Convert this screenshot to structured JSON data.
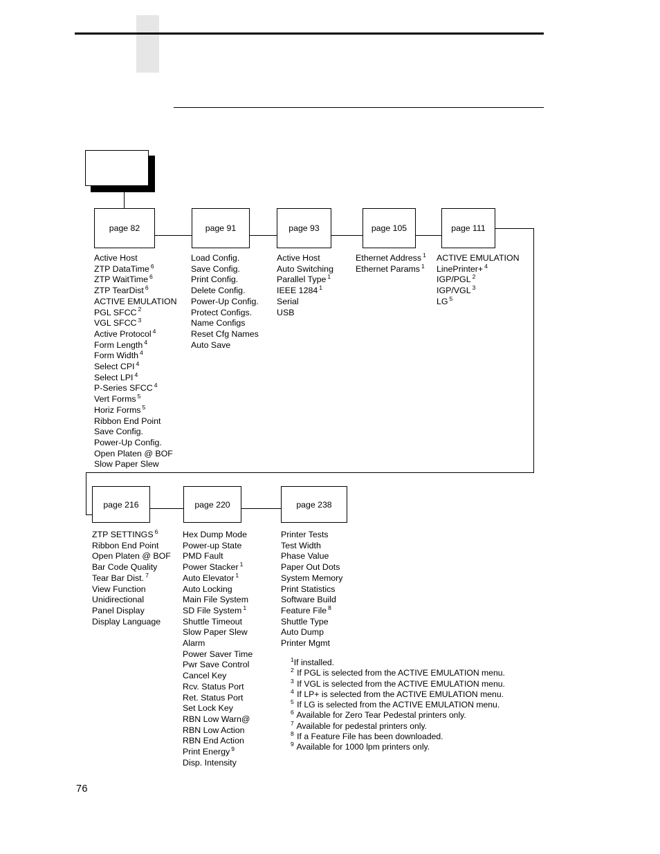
{
  "page": {
    "number": "76"
  },
  "chart": {
    "root": {
      "label": ""
    },
    "row1": [
      {
        "id": "page-82",
        "label": "page 82"
      },
      {
        "id": "page-91",
        "label": "page 91"
      },
      {
        "id": "page-93",
        "label": "page 93"
      },
      {
        "id": "page-105",
        "label": "page 105"
      },
      {
        "id": "page-111",
        "label": "page 111"
      }
    ],
    "row2": [
      {
        "id": "page-216",
        "label": "page 216"
      },
      {
        "id": "page-220",
        "label": "page 220"
      },
      {
        "id": "page-238",
        "label": "page 238"
      }
    ],
    "columns": {
      "page82": [
        {
          "text": "Active Host",
          "note": ""
        },
        {
          "text": "ZTP DataTime",
          "note": "6"
        },
        {
          "text": "ZTP WaitTime",
          "note": "6"
        },
        {
          "text": "ZTP TearDist",
          "note": "6"
        },
        {
          "text": "ACTIVE EMULATION",
          "note": ""
        },
        {
          "text": "PGL SFCC",
          "note": "2"
        },
        {
          "text": "VGL SFCC",
          "note": "3"
        },
        {
          "text": "Active Protocol",
          "note": "4"
        },
        {
          "text": "Form Length",
          "note": "4"
        },
        {
          "text": "Form Width",
          "note": "4"
        },
        {
          "text": "Select CPI",
          "note": "4"
        },
        {
          "text": "Select LPI",
          "note": "4"
        },
        {
          "text": "P-Series SFCC",
          "note": "4"
        },
        {
          "text": "Vert Forms",
          "note": "5"
        },
        {
          "text": "Horiz Forms",
          "note": "5"
        },
        {
          "text": "Ribbon End Point",
          "note": ""
        },
        {
          "text": "Save Config.",
          "note": ""
        },
        {
          "text": "Power-Up Config.",
          "note": ""
        },
        {
          "text": "Open Platen @ BOF",
          "note": ""
        },
        {
          "text": "Slow Paper Slew",
          "note": ""
        }
      ],
      "page91": [
        {
          "text": "Load Config.",
          "note": ""
        },
        {
          "text": "Save Config.",
          "note": ""
        },
        {
          "text": "Print Config.",
          "note": ""
        },
        {
          "text": "Delete Config.",
          "note": ""
        },
        {
          "text": "Power-Up Config.",
          "note": ""
        },
        {
          "text": "Protect Configs.",
          "note": ""
        },
        {
          "text": "Name Configs",
          "note": ""
        },
        {
          "text": "Reset Cfg Names",
          "note": ""
        },
        {
          "text": "Auto Save",
          "note": ""
        }
      ],
      "page93": [
        {
          "text": "Active Host",
          "note": ""
        },
        {
          "text": "Auto Switching",
          "note": ""
        },
        {
          "text": "Parallel Type",
          "note": "1"
        },
        {
          "text": "IEEE 1284",
          "note": "1"
        },
        {
          "text": "Serial",
          "note": ""
        },
        {
          "text": "USB",
          "note": ""
        }
      ],
      "page105": [
        {
          "text": "Ethernet Address",
          "note": "1"
        },
        {
          "text": "Ethernet Params",
          "note": "1"
        }
      ],
      "page111": [
        {
          "text": "ACTIVE EMULATION",
          "note": ""
        },
        {
          "text": "LinePrinter+",
          "note": "4"
        },
        {
          "text": "IGP/PGL",
          "note": "2"
        },
        {
          "text": "IGP/VGL",
          "note": "3"
        },
        {
          "text": "LG",
          "note": "5"
        }
      ],
      "page216": [
        {
          "text": "ZTP SETTINGS",
          "note": "6"
        },
        {
          "text": "Ribbon End Point",
          "note": ""
        },
        {
          "text": "Open Platen @ BOF",
          "note": ""
        },
        {
          "text": "Bar Code Quality",
          "note": ""
        },
        {
          "text": "Tear Bar Dist.",
          "note": "7"
        },
        {
          "text": "View Function",
          "note": ""
        },
        {
          "text": "Unidirectional",
          "note": ""
        },
        {
          "text": "Panel Display",
          "note": ""
        },
        {
          "text": "Display Language",
          "note": ""
        }
      ],
      "page220": [
        {
          "text": "Hex Dump Mode",
          "note": ""
        },
        {
          "text": "Power-up State",
          "note": ""
        },
        {
          "text": "PMD Fault",
          "note": ""
        },
        {
          "text": "Power Stacker",
          "note": "1"
        },
        {
          "text": "Auto Elevator",
          "note": "1"
        },
        {
          "text": "Auto Locking",
          "note": ""
        },
        {
          "text": "Main File System",
          "note": ""
        },
        {
          "text": "SD File System",
          "note": "1"
        },
        {
          "text": "Shuttle Timeout",
          "note": ""
        },
        {
          "text": "Slow Paper Slew",
          "note": ""
        },
        {
          "text": "Alarm",
          "note": ""
        },
        {
          "text": "Power Saver Time",
          "note": ""
        },
        {
          "text": "Pwr Save Control",
          "note": ""
        },
        {
          "text": "Cancel Key",
          "note": ""
        },
        {
          "text": "Rcv. Status Port",
          "note": ""
        },
        {
          "text": "Ret. Status Port",
          "note": ""
        },
        {
          "text": "Set Lock Key",
          "note": ""
        },
        {
          "text": "RBN Low Warn@",
          "note": ""
        },
        {
          "text": "RBN Low Action",
          "note": ""
        },
        {
          "text": "RBN End Action",
          "note": ""
        },
        {
          "text": "Print Energy",
          "note": "9"
        },
        {
          "text": "Disp. Intensity",
          "note": ""
        }
      ],
      "page238": [
        {
          "text": "Printer Tests",
          "note": ""
        },
        {
          "text": "Test Width",
          "note": ""
        },
        {
          "text": "Phase Value",
          "note": ""
        },
        {
          "text": "Paper Out Dots",
          "note": ""
        },
        {
          "text": "System Memory",
          "note": ""
        },
        {
          "text": "Print Statistics",
          "note": ""
        },
        {
          "text": "Software Build",
          "note": ""
        },
        {
          "text": "Feature File",
          "note": "8"
        },
        {
          "text": "Shuttle Type",
          "note": ""
        },
        {
          "text": "Auto Dump",
          "note": ""
        },
        {
          "text": "Printer Mgmt",
          "note": ""
        }
      ]
    }
  },
  "footnotes": [
    {
      "mark": "1",
      "text": "If installed.",
      "tight": true
    },
    {
      "mark": "2",
      "text": " If PGL is selected from the ACTIVE EMULATION menu.",
      "tight": false
    },
    {
      "mark": "3",
      "text": " If VGL is selected from the ACTIVE EMULATION menu.",
      "tight": false
    },
    {
      "mark": "4",
      "text": " If LP+ is selected from the ACTIVE EMULATION menu.",
      "tight": false
    },
    {
      "mark": "5",
      "text": " If LG is selected from the ACTIVE EMULATION menu.",
      "tight": false
    },
    {
      "mark": "6",
      "text": " Available for Zero Tear Pedestal printers only.",
      "tight": false
    },
    {
      "mark": "7",
      "text": " Available for pedestal printers only.",
      "tight": false
    },
    {
      "mark": "8",
      "text": " If a Feature File has been downloaded.",
      "tight": false
    },
    {
      "mark": "9",
      "text": " Available for 1000 lpm printers only.",
      "tight": false
    }
  ]
}
